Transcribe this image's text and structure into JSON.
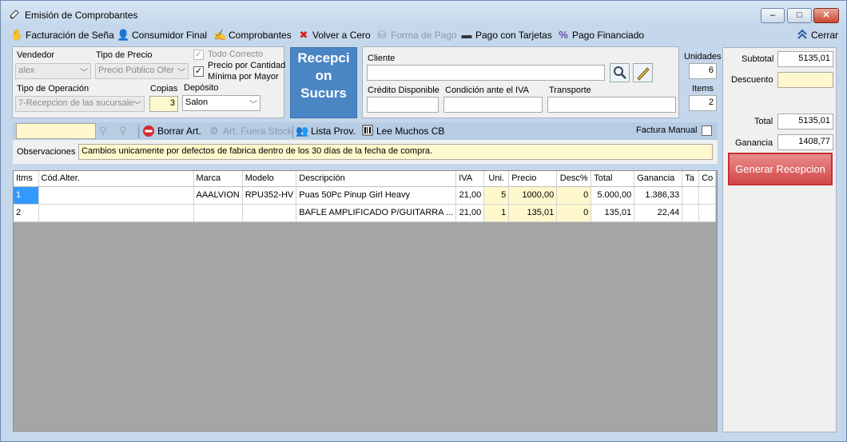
{
  "window": {
    "title": "Emisión de Comprobantes",
    "min": "–",
    "max": "□",
    "close": "✕"
  },
  "toolbar": {
    "items": [
      {
        "label": "Facturación de Seña",
        "icon": "hand-money-icon",
        "glyph": "✋",
        "disabled": false
      },
      {
        "label": "Consumidor Final",
        "icon": "user-icon",
        "glyph": "👤",
        "disabled": false
      },
      {
        "label": "Comprobantes",
        "icon": "documents-icon",
        "glyph": "✍",
        "disabled": false
      },
      {
        "label": "Volver a Cero",
        "icon": "red-x-icon",
        "glyph": "✖",
        "disabled": false
      },
      {
        "label": "Forma de Pago",
        "icon": "coins-icon",
        "glyph": "⛁",
        "disabled": true
      },
      {
        "label": "Pago con Tarjetas",
        "icon": "card-icon",
        "glyph": "▬",
        "disabled": false
      },
      {
        "label": "Pago Financiado",
        "icon": "percent-icon",
        "glyph": "%",
        "disabled": false
      }
    ],
    "close_label": "Cerrar"
  },
  "form": {
    "vendedor_label": "Vendedor",
    "vendedor_value": "alex",
    "tipo_precio_label": "Tipo de Precio",
    "tipo_precio_value": "Precio Público Ofer",
    "todo_correcto_label": "Todo Correcto",
    "precio_cantidad_label": "Precio por Cantidad",
    "minima_mayor_label": "Mínima por Mayor",
    "tipo_operacion_label": "Tipo de Operación",
    "tipo_operacion_value": "7-Recepcion de las sucursale",
    "copias_label": "Copias",
    "copias_value": "3",
    "deposito_label": "Depósito",
    "deposito_value": "Salon",
    "big_button": "Recepci on Sucurs",
    "cliente_label": "Cliente",
    "cliente_value": "",
    "credito_label": "Crédito Disponible",
    "iva_label": "Condición ante el IVA",
    "transporte_label": "Transporte",
    "unidades_label": "Unidades",
    "unidades_value": "6",
    "items_label": "Items",
    "items_value": "2"
  },
  "totals": {
    "subtotal_label": "Subtotal",
    "subtotal_value": "5135,01",
    "descuento_label": "Descuento",
    "descuento_value": "",
    "total_label": "Total",
    "total_value": "5135,01",
    "ganancia_label": "Ganancia",
    "ganancia_value": "1408,77",
    "generar_label": "Generar Recepcion"
  },
  "strip": {
    "borrar_label": "Borrar Art.",
    "fuera_stock_label": "Art. Fuera Stock",
    "lista_prov_label": "Lista Prov.",
    "lee_cb_label": "Lee Muchos CB",
    "factura_manual_label": "Factura Manual"
  },
  "observaciones": {
    "label": "Observaciones",
    "value": "Cambios unicamente por defectos de fabrica dentro de los 30 días de la fecha de compra."
  },
  "grid": {
    "columns": [
      "Itms",
      "Cód.Alter.",
      "Marca",
      "Modelo",
      "Descripción",
      "IVA",
      "Uni.",
      "Precio",
      "Desc%",
      "Total",
      "Ganancia",
      "Ta",
      "Co"
    ],
    "rows": [
      [
        "1",
        "",
        "AAALVION",
        "RPU352-HV",
        "Puas 50Pc Pinup Girl Heavy",
        "21,00",
        "5",
        "1000,00",
        "0",
        "5.000,00",
        "1.386,33",
        "",
        ""
      ],
      [
        "2",
        "",
        "",
        "",
        "BAFLE AMPLIFICADO P/GUITARRA ...",
        "21,00",
        "1",
        "135,01",
        "0",
        "135,01",
        "22,44",
        "",
        ""
      ]
    ]
  }
}
